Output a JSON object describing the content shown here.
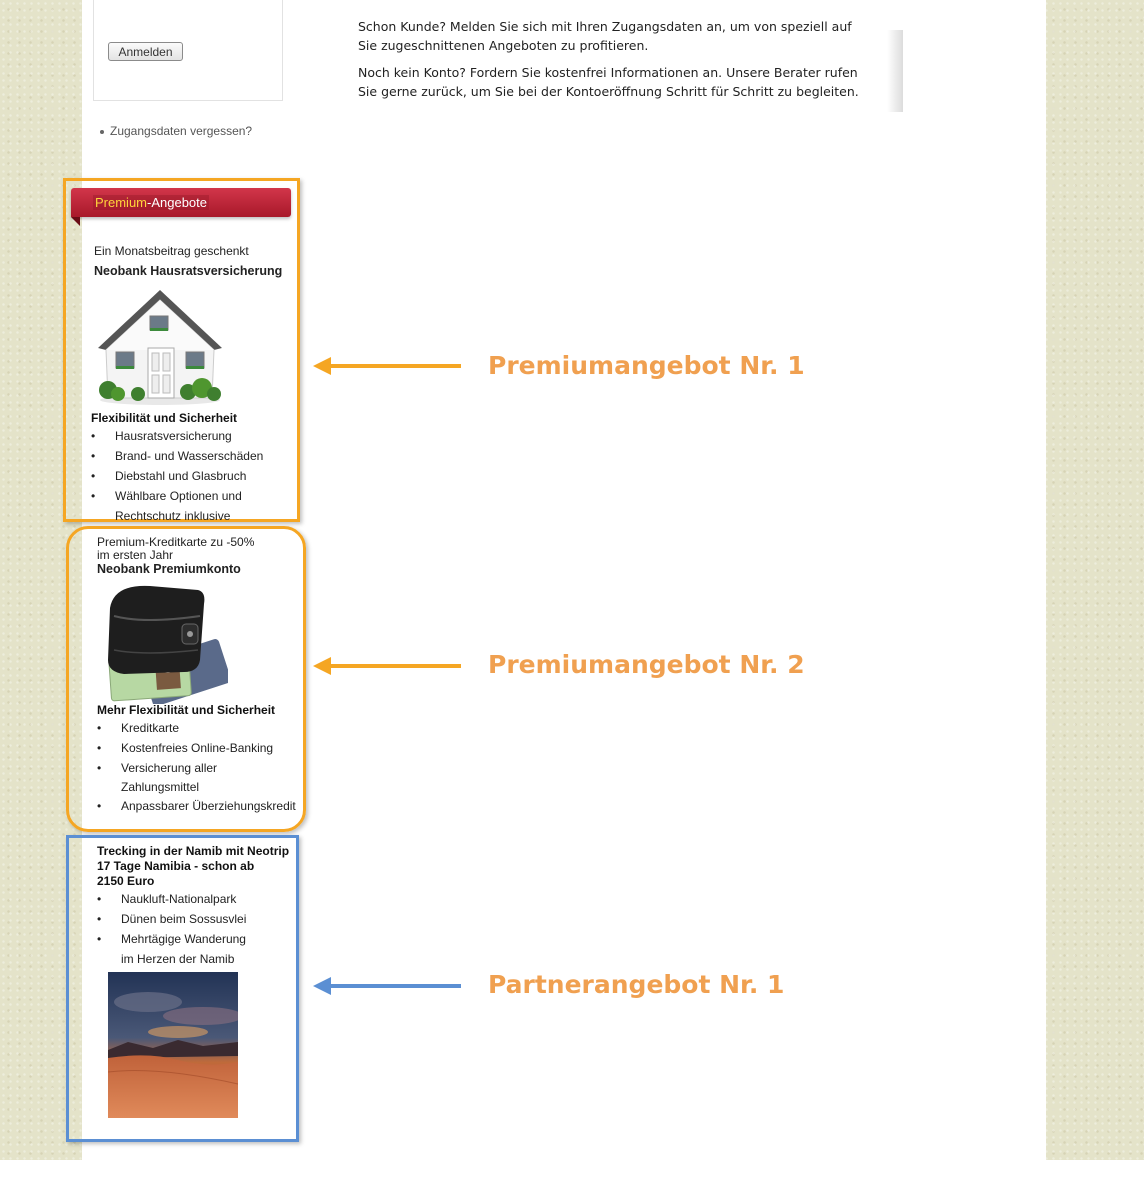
{
  "login": {
    "button_label": "Anmelden",
    "forgot_label": "Zugangsdaten vergessen?"
  },
  "intro": {
    "paragraph1": "Schon Kunde? Melden Sie sich mit Ihren Zugangsdaten an, um von speziell auf Sie zugeschnittenen Angeboten zu profitieren.",
    "paragraph2": "Noch kein Konto? Fordern Sie kostenfrei Informationen an. Unsere Berater rufen Sie gerne zurück, um Sie bei der Kontoeröffnung Schritt für Schritt zu begleiten."
  },
  "header": {
    "highlight": "Premium",
    "rest": "-Angebote"
  },
  "offer1": {
    "teaser": "Ein Monatsbeitrag geschenkt",
    "title": "Neobank Hausratsversicherung",
    "subtitle": "Flexibilität und Sicherheit",
    "items": [
      "Hausratsversicherung",
      "Brand- und Wasserschäden",
      "Diebstahl und Glasbruch",
      "Wählbare Optionen und",
      "Rechtschutz inklusive"
    ]
  },
  "offer2": {
    "teaser_line1": "Premium-Kreditkarte zu -50%",
    "teaser_line2": "im ersten Jahr",
    "title": "Neobank Premiumkonto",
    "subtitle": "Mehr Flexibilität und Sicherheit",
    "items": [
      "Kreditkarte",
      "Kostenfreies Online-Banking",
      "Versicherung aller",
      "Zahlungsmittel",
      "Anpassbarer Überziehungskredit"
    ]
  },
  "offer3": {
    "title_line1": "Trecking in der Namib mit Neotrip",
    "title_line2": "17 Tage Namibia - schon ab",
    "title_line3": "2150 Euro",
    "items": [
      "Naukluft-Nationalpark",
      "Dünen beim Sossusvlei",
      "Mehrtägige Wanderung",
      "im Herzen der Namib"
    ]
  },
  "callouts": {
    "c1": "Premiumangebot Nr. 1",
    "c2": "Premiumangebot Nr. 2",
    "c3": "Partnerangebot Nr. 1"
  },
  "colors": {
    "premium_frame": "#f5a623",
    "partner_frame": "#5b8fd3",
    "callout_text": "#f0a050",
    "ribbon": "#c02638"
  }
}
